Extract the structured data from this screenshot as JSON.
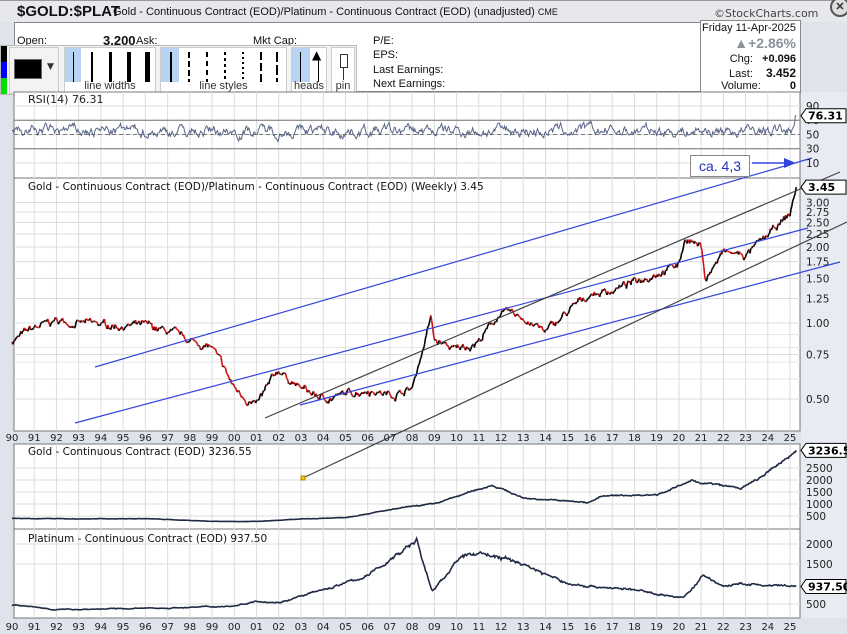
{
  "header": {
    "symbol": "$GOLD:$PLAT",
    "description": "Gold - Continuous Contract (EOD)/Platinum - Continuous Contract (EOD) (unadjusted)",
    "exchange": "CME",
    "brand": "©StockCharts.com"
  },
  "info": {
    "open_label": "Open:",
    "open_value": "3.200",
    "ask_label": "Ask:",
    "mktcap_label": "Mkt Cap:",
    "pe_label": "P/E:",
    "eps_label": "EPS:",
    "last_earnings_label": "Last Earnings:",
    "next_earnings_label": "Next Earnings:",
    "date": "Friday  11-Apr-2025",
    "pct_change": "+2.86%",
    "chg_label": "Chg:",
    "chg_value": "+0.096",
    "last_label": "Last:",
    "last_value": "3.452",
    "volume_label": "Volume:",
    "volume_value": "0"
  },
  "toolbar": {
    "line_widths_label": "line widths",
    "line_styles_label": "line styles",
    "heads_label": "heads",
    "pin_label": "pin",
    "swatch_color": "#000000"
  },
  "annotation": {
    "text": "ca. 4,3",
    "color": "#2233bb"
  },
  "chart_data": [
    {
      "type": "line",
      "panel": "rsi",
      "title": "RSI(14) 76.31",
      "last_value": "76.31",
      "yticks": [
        "90",
        "70",
        "50",
        "30",
        "10"
      ],
      "ylim": [
        0,
        100
      ]
    },
    {
      "type": "line",
      "panel": "price",
      "title": "Gold - Continuous Contract (EOD)/Platinum - Continuous Contract (EOD) (Weekly) 3.45",
      "scale": "log",
      "last_value": "3.45",
      "yticks": [
        "3.00",
        "2.75",
        "2.50",
        "2.25",
        "2.00",
        "1.75",
        "1.50",
        "1.25",
        "1.00",
        "0.75",
        "0.50"
      ],
      "x": [
        1990,
        1991,
        1992,
        1993,
        1994,
        1995,
        1996,
        1997,
        1998,
        1999,
        2000,
        2001,
        2002,
        2003,
        2004,
        2005,
        2006,
        2007,
        2008,
        2008.85,
        2009,
        2010,
        2011,
        2012,
        2013,
        2014,
        2015,
        2016,
        2017,
        2018,
        2019,
        2020,
        2020.3,
        2021,
        2021.2,
        2022,
        2023,
        2024,
        2025,
        2025.28
      ],
      "y": [
        0.85,
        0.95,
        1.02,
        1.0,
        0.98,
        0.98,
        0.97,
        0.92,
        0.85,
        0.8,
        0.55,
        0.47,
        0.65,
        0.55,
        0.5,
        0.52,
        0.55,
        0.52,
        0.55,
        1.05,
        0.85,
        0.78,
        0.85,
        1.1,
        1.05,
        0.92,
        1.1,
        1.3,
        1.35,
        1.45,
        1.6,
        1.7,
        2.2,
        2.0,
        1.5,
        1.9,
        1.85,
        2.2,
        2.7,
        3.45
      ],
      "colors": {
        "up": "#000000",
        "down": "#d01010"
      },
      "trendlines_blue": "#3344dd",
      "trendlines_black": "#444444"
    },
    {
      "type": "line",
      "panel": "gold",
      "title": "Gold - Continuous Contract (EOD) 3236.55",
      "last_value": "3236.55",
      "yticks": [
        "2500",
        "2000",
        "1500",
        "1000",
        "500"
      ],
      "x": [
        1990,
        1993,
        1996,
        1999,
        2001,
        2003,
        2005,
        2006,
        2008,
        2009,
        2011.6,
        2013,
        2015.9,
        2016.5,
        2019,
        2020.6,
        2022.8,
        2023.5,
        2024,
        2025.28
      ],
      "y": [
        400,
        380,
        390,
        280,
        270,
        370,
        440,
        600,
        900,
        1000,
        1800,
        1250,
        1060,
        1320,
        1400,
        1950,
        1650,
        2000,
        2300,
        3236.55
      ]
    },
    {
      "type": "line",
      "panel": "platinum",
      "title": "Platinum - Continuous Contract (EOD) 937.50",
      "last_value": "937.50",
      "yticks": [
        "2000",
        "1500",
        "500"
      ],
      "x": [
        1990,
        1992,
        1997,
        2000,
        2001,
        2002,
        2004,
        2006,
        2008.2,
        2008.9,
        2009.5,
        2010,
        2011,
        2013,
        2015,
        2016,
        2018,
        2020.2,
        2021.1,
        2022,
        2023,
        2024,
        2025.28
      ],
      "y": [
        480,
        360,
        400,
        450,
        580,
        540,
        850,
        1200,
        2100,
        800,
        1200,
        1600,
        1800,
        1500,
        1000,
        950,
        850,
        650,
        1200,
        950,
        1000,
        950,
        937.5
      ]
    },
    {
      "xticks": [
        "90",
        "91",
        "92",
        "93",
        "94",
        "95",
        "96",
        "97",
        "98",
        "99",
        "00",
        "01",
        "02",
        "03",
        "04",
        "05",
        "06",
        "07",
        "08",
        "09",
        "10",
        "11",
        "12",
        "13",
        "14",
        "15",
        "16",
        "17",
        "18",
        "19",
        "20",
        "21",
        "22",
        "23",
        "24",
        "25"
      ]
    }
  ]
}
